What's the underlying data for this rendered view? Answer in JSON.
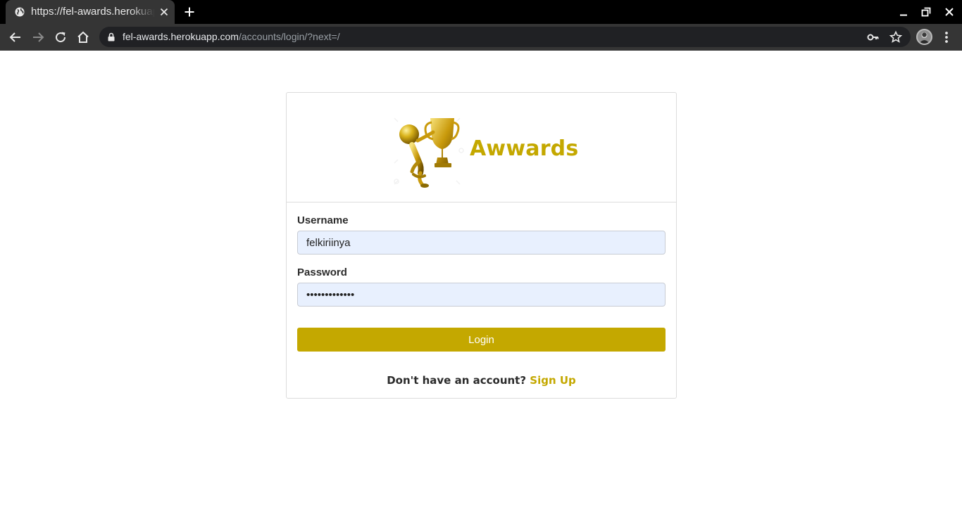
{
  "browser": {
    "tab_title": "https://fel-awards.herokuapp.com/accounts/login/?next=/",
    "url_host": "fel-awards.herokuapp.com",
    "url_path": "/accounts/login/?next=/"
  },
  "login": {
    "brand": "Awwards",
    "username_label": "Username",
    "username_value": "felkiriinya",
    "password_label": "Password",
    "password_value": "felkiriinya12",
    "login_label": "Login",
    "no_account_text": "Don't have an account?",
    "signup_label": "Sign Up"
  },
  "colors": {
    "accent": "#c4a800",
    "autofill_bg": "#e8f0fe",
    "chrome_dark": "#353535"
  },
  "icons": [
    "globe-icon",
    "close-icon",
    "plus-icon",
    "minimize-icon",
    "restore-icon",
    "back-icon",
    "forward-icon",
    "reload-icon",
    "home-icon",
    "lock-icon",
    "key-icon",
    "star-icon",
    "kebab-menu-icon",
    "trophy-logo"
  ]
}
